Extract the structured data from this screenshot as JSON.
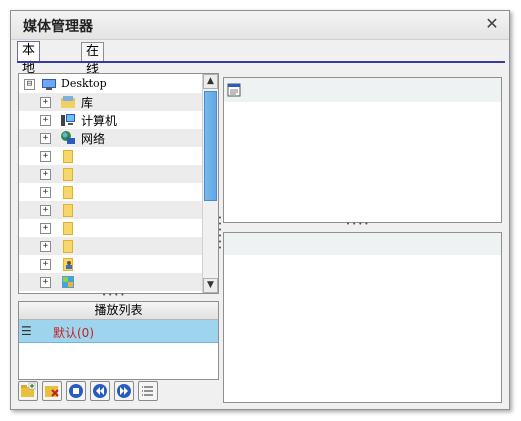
{
  "window": {
    "title": "媒体管理器",
    "close_glyph": "✕"
  },
  "tabs": [
    {
      "label": "本地文件",
      "active": true
    },
    {
      "label": "在线高清",
      "active": false
    }
  ],
  "tree": {
    "items": [
      {
        "label": "Desktop",
        "icon": "desktop-icon",
        "expander": "⊟",
        "level": 0
      },
      {
        "label": "库",
        "icon": "library-icon",
        "expander": "+",
        "level": 1
      },
      {
        "label": "计算机",
        "icon": "computer-icon",
        "expander": "+",
        "level": 1
      },
      {
        "label": "网络",
        "icon": "network-icon",
        "expander": "+",
        "level": 1
      },
      {
        "label": "",
        "icon": "folder-icon",
        "expander": "+",
        "level": 1
      },
      {
        "label": "",
        "icon": "folder-icon",
        "expander": "+",
        "level": 1
      },
      {
        "label": "",
        "icon": "folder-icon",
        "expander": "+",
        "level": 1
      },
      {
        "label": "",
        "icon": "folder-icon",
        "expander": "+",
        "level": 1
      },
      {
        "label": "",
        "icon": "folder-icon",
        "expander": "+",
        "level": 1
      },
      {
        "label": "",
        "icon": "folder-icon",
        "expander": "+",
        "level": 1
      },
      {
        "label": "",
        "icon": "user-folder-icon",
        "expander": "+",
        "level": 1
      },
      {
        "label": "",
        "icon": "control-panel-icon",
        "expander": "+",
        "level": 1
      }
    ]
  },
  "splitter_grip": "••••",
  "playlist": {
    "header": "播放列表",
    "items": [
      {
        "icon": "list-icon",
        "label": "默认(0)"
      }
    ]
  },
  "toolbar": {
    "buttons": [
      {
        "name": "add-folder-button",
        "icon": "folder-add-icon"
      },
      {
        "name": "delete-button",
        "icon": "delete-icon"
      },
      {
        "name": "stop-button",
        "icon": "stop-icon"
      },
      {
        "name": "previous-button",
        "icon": "previous-icon"
      },
      {
        "name": "next-button",
        "icon": "next-icon"
      },
      {
        "name": "list-button",
        "icon": "list-icon"
      }
    ]
  },
  "colors": {
    "accent": "#3a3aa0",
    "selection": "#9ed4ee",
    "playlist_text": "#c62020"
  }
}
